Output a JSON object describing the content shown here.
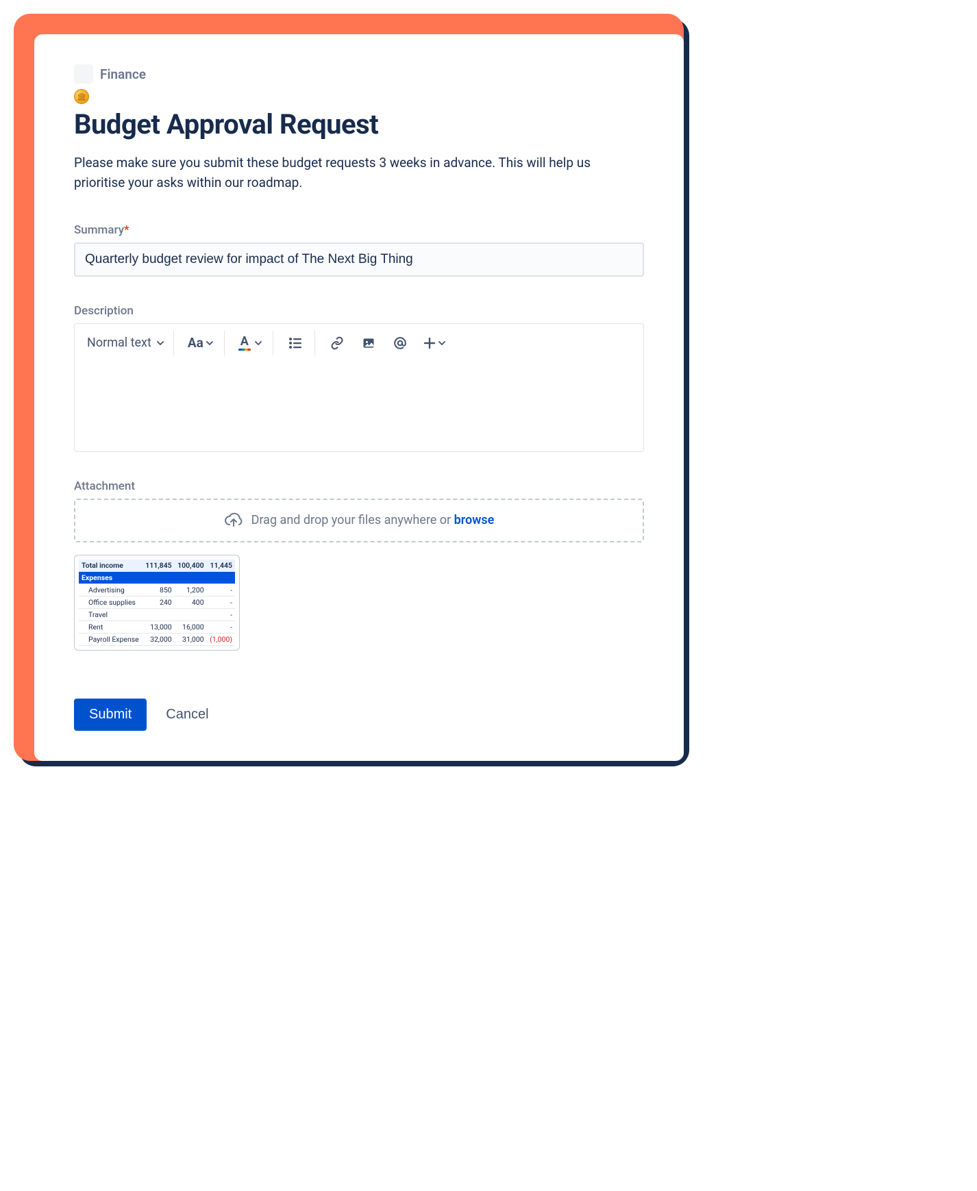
{
  "breadcrumb": {
    "category": "Finance"
  },
  "page": {
    "title": "Budget Approval Request",
    "subtitle": "Please make sure you submit these budget requests 3 weeks in advance. This will help us prioritise your asks within our roadmap."
  },
  "summary": {
    "label": "Summary",
    "required_marker": "*",
    "value": "Quarterly budget review for impact of The Next Big Thing"
  },
  "description": {
    "label": "Description",
    "style_select": "Normal text",
    "case_btn": "Aa"
  },
  "attachment": {
    "label": "Attachment",
    "drop_text": "Drag and drop your files anywhere or ",
    "browse": "browse"
  },
  "thumbnail": {
    "total_income": {
      "label": "Total income",
      "c1": "111,845",
      "c2": "100,400",
      "c3": "11,445"
    },
    "section": "Expenses",
    "rows": [
      {
        "label": "Advertising",
        "c1": "850",
        "c2": "1,200",
        "c3": "-"
      },
      {
        "label": "Office supplies",
        "c1": "240",
        "c2": "400",
        "c3": "-"
      },
      {
        "label": "Travel",
        "c1": "",
        "c2": "",
        "c3": "-"
      },
      {
        "label": "Rent",
        "c1": "13,000",
        "c2": "16,000",
        "c3": "-"
      },
      {
        "label": "Payroll Expense",
        "c1": "32,000",
        "c2": "31,000",
        "c3": "(1,000)"
      }
    ]
  },
  "actions": {
    "submit": "Submit",
    "cancel": "Cancel"
  }
}
